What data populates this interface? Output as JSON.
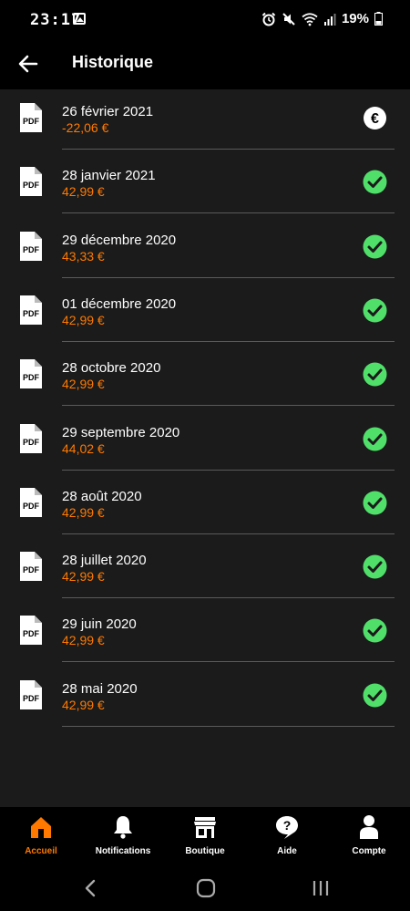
{
  "status_bar": {
    "time": "23:17",
    "battery": "19%"
  },
  "header": {
    "title": "Historique"
  },
  "invoices": [
    {
      "date": "26 février 2021",
      "amount": "-22,06 €",
      "status": "euro-icon"
    },
    {
      "date": "28 janvier 2021",
      "amount": "42,99 €",
      "status": "check-icon"
    },
    {
      "date": "29 décembre 2020",
      "amount": "43,33 €",
      "status": "check-icon"
    },
    {
      "date": "01 décembre 2020",
      "amount": "42,99 €",
      "status": "check-icon"
    },
    {
      "date": "28 octobre 2020",
      "amount": "42,99 €",
      "status": "check-icon"
    },
    {
      "date": "29 septembre 2020",
      "amount": "44,02 €",
      "status": "check-icon"
    },
    {
      "date": "28 août 2020",
      "amount": "42,99 €",
      "status": "check-icon"
    },
    {
      "date": "28 juillet 2020",
      "amount": "42,99 €",
      "status": "check-icon"
    },
    {
      "date": "29 juin 2020",
      "amount": "42,99 €",
      "status": "check-icon"
    },
    {
      "date": "28 mai 2020",
      "amount": "42,99 €",
      "status": "check-icon"
    }
  ],
  "pdf_label": "PDF",
  "euro_symbol": "€",
  "bottom_nav": {
    "items": [
      {
        "label": "Accueil",
        "icon": "home-icon",
        "active": true
      },
      {
        "label": "Notifications",
        "icon": "bell-icon",
        "active": false
      },
      {
        "label": "Boutique",
        "icon": "shop-icon",
        "active": false
      },
      {
        "label": "Aide",
        "icon": "help-icon",
        "active": false
      },
      {
        "label": "Compte",
        "icon": "account-icon",
        "active": false
      }
    ]
  },
  "colors": {
    "accent": "#ff7900",
    "check": "#50e06a",
    "list_bg": "#1b1b1b",
    "divider": "#5a5a5a"
  }
}
